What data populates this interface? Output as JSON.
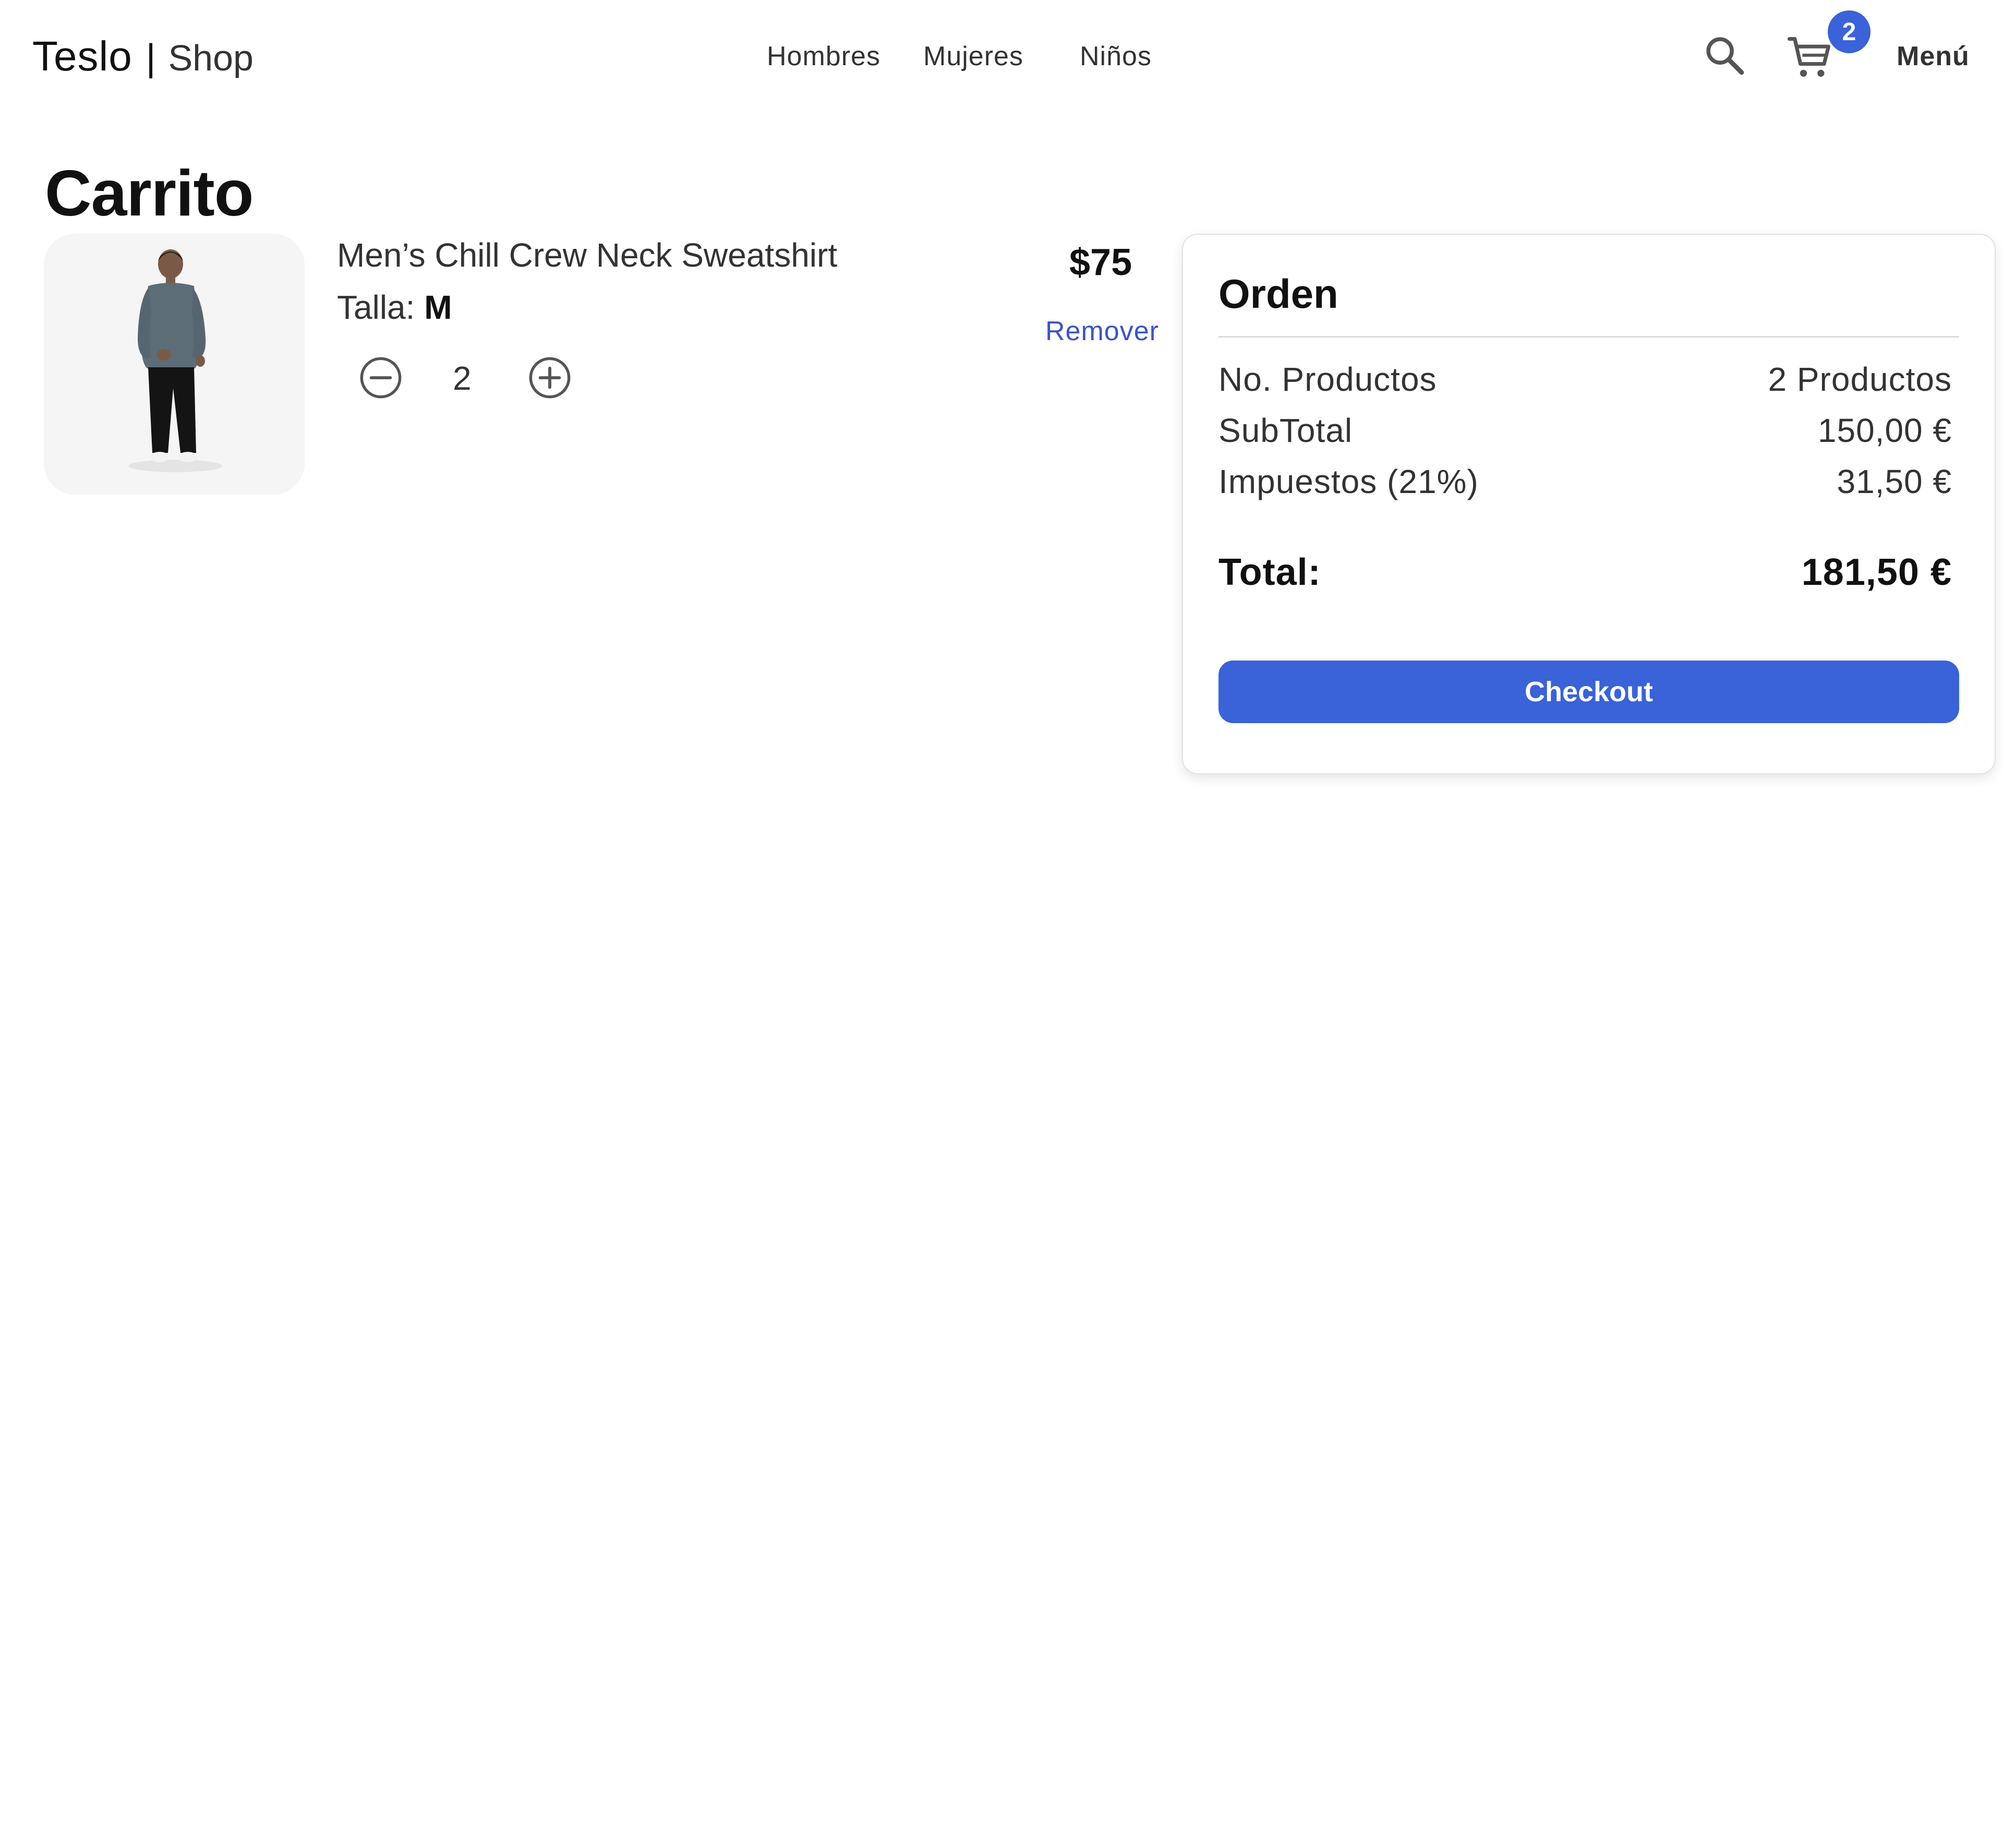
{
  "navbar": {
    "brand_name": "Teslo",
    "brand_separator": "|",
    "brand_shop": "Shop",
    "links": [
      "Hombres",
      "Mujeres",
      "Niños"
    ],
    "cart_count": "2",
    "menu_label": "Menú",
    "icons": {
      "search": "search-icon",
      "cart": "shopping-cart-icon"
    }
  },
  "page": {
    "title": "Carrito"
  },
  "cart_item": {
    "name": "Men’s Chill Crew Neck Sweatshirt",
    "size_label": "Talla:",
    "size_value": "M",
    "quantity": "2",
    "price": "$75",
    "remove_label": "Remover",
    "icons": {
      "decrement": "minus-circle-icon",
      "increment": "plus-circle-icon"
    }
  },
  "order": {
    "title": "Orden",
    "rows": [
      {
        "label": "No. Productos",
        "value": "2 Productos"
      },
      {
        "label": "SubTotal",
        "value": "150,00 €"
      },
      {
        "label": "Impuestos (21%)",
        "value": "31,50 €"
      }
    ],
    "total_label": "Total:",
    "total_value": "181,50 €",
    "checkout_label": "Checkout"
  },
  "colors": {
    "accent": "#3a62d9",
    "link": "#3a54c8"
  }
}
